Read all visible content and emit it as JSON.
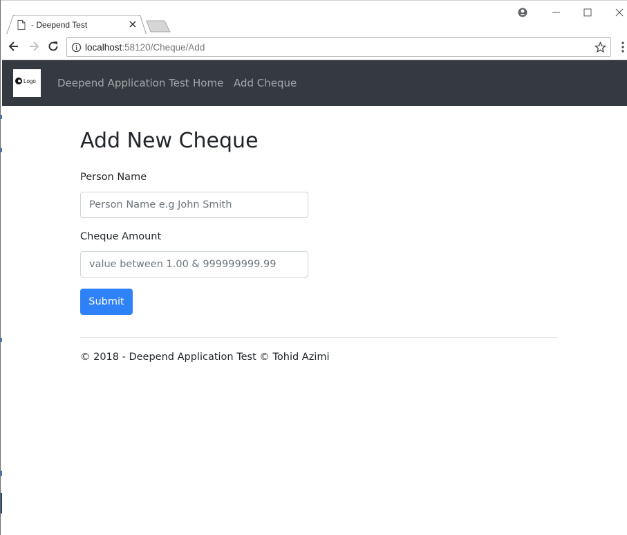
{
  "browser": {
    "tab_title": "- Deepend Test",
    "url_host": "localhost",
    "url_path": ":58120/Cheque/Add"
  },
  "navbar": {
    "logo_text": "Logo",
    "brand": "Deepend Application Test",
    "links": [
      {
        "label": "Home"
      },
      {
        "label": "Add Cheque"
      }
    ],
    "background": "#343a40"
  },
  "page": {
    "title": "Add New Cheque",
    "person_name": {
      "label": "Person Name",
      "placeholder": "Person Name e.g John Smith",
      "value": ""
    },
    "cheque_amount": {
      "label": "Cheque Amount",
      "placeholder": "value between 1.00 & 999999999.99",
      "value": ""
    },
    "submit_label": "Submit",
    "footer": "© 2018 - Deepend Application Test © Tohid Azimi"
  },
  "colors": {
    "primary": "#2f81f7",
    "navbar": "#343a40"
  }
}
